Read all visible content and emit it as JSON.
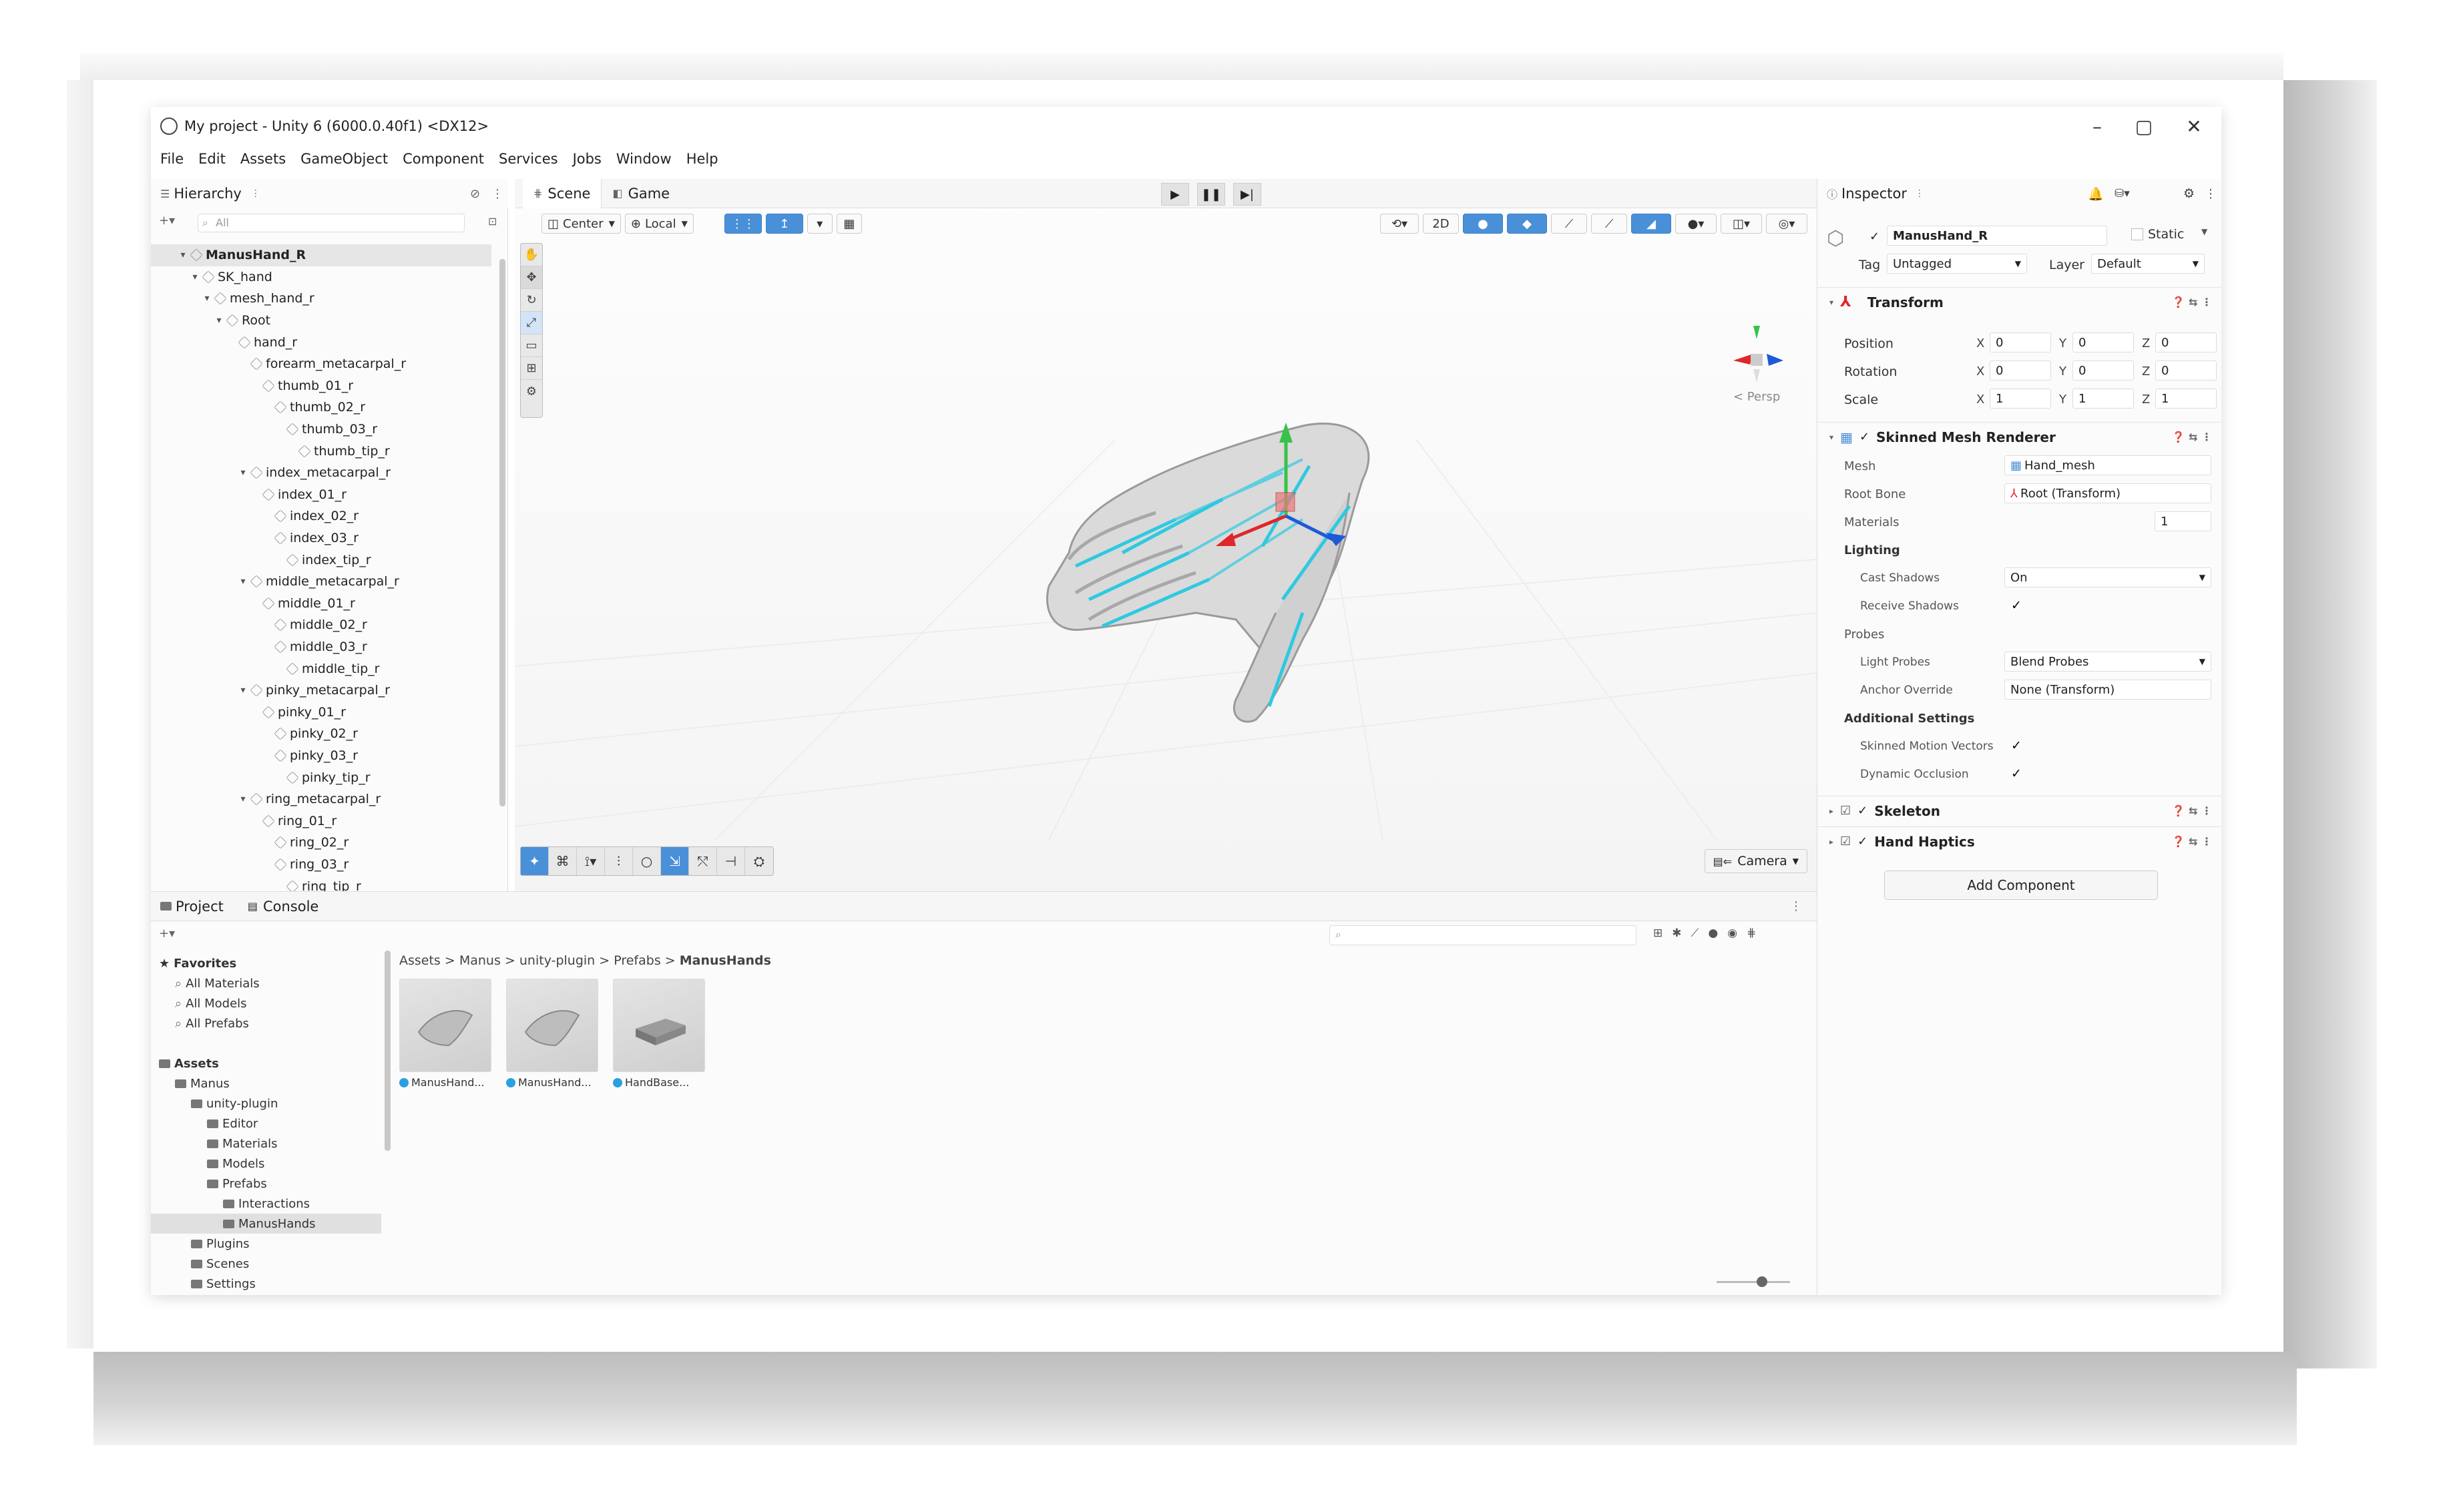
{
  "window": {
    "title": "My project - Unity 6 (6000.0.40f1) <DX12>",
    "minimize": "–",
    "maximize": "▢",
    "close": "✕"
  },
  "menu": [
    "File",
    "Edit",
    "Assets",
    "GameObject",
    "Component",
    "Services",
    "Jobs",
    "Window",
    "Help"
  ],
  "hierarchy": {
    "tab_label": "Hierarchy",
    "search_placeholder": "All",
    "items": [
      {
        "label": "ManusHand_R",
        "depth": 0,
        "caret": "▾",
        "selected": true
      },
      {
        "label": "SK_hand",
        "depth": 1,
        "caret": "▾"
      },
      {
        "label": "mesh_hand_r",
        "depth": 2,
        "caret": "▾"
      },
      {
        "label": "Root",
        "depth": 3,
        "caret": "▾"
      },
      {
        "label": "hand_r",
        "depth": 4,
        "caret": ""
      },
      {
        "label": "forearm_metacarpal_r",
        "depth": 5,
        "caret": ""
      },
      {
        "label": "thumb_01_r",
        "depth": 6,
        "caret": ""
      },
      {
        "label": "thumb_02_r",
        "depth": 7,
        "caret": ""
      },
      {
        "label": "thumb_03_r",
        "depth": 8,
        "caret": ""
      },
      {
        "label": "thumb_tip_r",
        "depth": 9,
        "caret": ""
      },
      {
        "label": "index_metacarpal_r",
        "depth": 5,
        "caret": "▾"
      },
      {
        "label": "index_01_r",
        "depth": 6,
        "caret": ""
      },
      {
        "label": "index_02_r",
        "depth": 7,
        "caret": ""
      },
      {
        "label": "index_03_r",
        "depth": 7,
        "caret": ""
      },
      {
        "label": "index_tip_r",
        "depth": 8,
        "caret": ""
      },
      {
        "label": "middle_metacarpal_r",
        "depth": 5,
        "caret": "▾"
      },
      {
        "label": "middle_01_r",
        "depth": 6,
        "caret": ""
      },
      {
        "label": "middle_02_r",
        "depth": 7,
        "caret": ""
      },
      {
        "label": "middle_03_r",
        "depth": 7,
        "caret": ""
      },
      {
        "label": "middle_tip_r",
        "depth": 8,
        "caret": ""
      },
      {
        "label": "pinky_metacarpal_r",
        "depth": 5,
        "caret": "▾"
      },
      {
        "label": "pinky_01_r",
        "depth": 6,
        "caret": ""
      },
      {
        "label": "pinky_02_r",
        "depth": 7,
        "caret": ""
      },
      {
        "label": "pinky_03_r",
        "depth": 7,
        "caret": ""
      },
      {
        "label": "pinky_tip_r",
        "depth": 8,
        "caret": ""
      },
      {
        "label": "ring_metacarpal_r",
        "depth": 5,
        "caret": "▾"
      },
      {
        "label": "ring_01_r",
        "depth": 6,
        "caret": ""
      },
      {
        "label": "ring_02_r",
        "depth": 7,
        "caret": ""
      },
      {
        "label": "ring_03_r",
        "depth": 7,
        "caret": ""
      },
      {
        "label": "ring_tip_r",
        "depth": 8,
        "caret": ""
      }
    ]
  },
  "scene": {
    "tab_scene": "Scene",
    "tab_game": "Game",
    "pivot_label": "Center",
    "space_label": "Local",
    "mode_2d": "2D",
    "persp_label": "< Persp",
    "camera_label": "Camera"
  },
  "project": {
    "tab_project": "Project",
    "tab_console": "Console",
    "tree": [
      {
        "label": "Favorites",
        "depth": 0,
        "kind": "star",
        "bold": true
      },
      {
        "label": "All Materials",
        "depth": 1,
        "kind": "search"
      },
      {
        "label": "All Models",
        "depth": 1,
        "kind": "search"
      },
      {
        "label": "All Prefabs",
        "depth": 1,
        "kind": "search"
      },
      {
        "label": "",
        "depth": 0,
        "kind": "blank"
      },
      {
        "label": "Assets",
        "depth": 0,
        "kind": "folder",
        "bold": true
      },
      {
        "label": "Manus",
        "depth": 1,
        "kind": "folder"
      },
      {
        "label": "unity-plugin",
        "depth": 2,
        "kind": "folder"
      },
      {
        "label": "Editor",
        "depth": 3,
        "kind": "folder"
      },
      {
        "label": "Materials",
        "depth": 3,
        "kind": "folder"
      },
      {
        "label": "Models",
        "depth": 3,
        "kind": "folder"
      },
      {
        "label": "Prefabs",
        "depth": 3,
        "kind": "folder"
      },
      {
        "label": "Interactions",
        "depth": 4,
        "kind": "folder"
      },
      {
        "label": "ManusHands",
        "depth": 4,
        "kind": "folder",
        "selected": true
      },
      {
        "label": "Plugins",
        "depth": 2,
        "kind": "folder"
      },
      {
        "label": "Scenes",
        "depth": 2,
        "kind": "folder"
      },
      {
        "label": "Settings",
        "depth": 2,
        "kind": "folder"
      }
    ],
    "breadcrumb": [
      "Assets",
      "Manus",
      "unity-plugin",
      "Prefabs",
      "ManusHands"
    ],
    "assets": [
      "ManusHand...",
      "ManusHand...",
      "HandBase..."
    ]
  },
  "inspector": {
    "tab_label": "Inspector",
    "object_name": "ManusHand_R",
    "static_label": "Static",
    "tag_label": "Tag",
    "tag_value": "Untagged",
    "layer_label": "Layer",
    "layer_value": "Default",
    "transform": {
      "title": "Transform",
      "position_label": "Position",
      "rotation_label": "Rotation",
      "scale_label": "Scale",
      "position": {
        "x": "0",
        "y": "0",
        "z": "0"
      },
      "rotation": {
        "x": "0",
        "y": "0",
        "z": "0"
      },
      "scale": {
        "x": "1",
        "y": "1",
        "z": "1"
      }
    },
    "smr": {
      "title": "Skinned Mesh Renderer",
      "mesh_label": "Mesh",
      "mesh_value": "Hand_mesh",
      "rootbone_label": "Root Bone",
      "rootbone_value": "Root (Transform)",
      "materials_label": "Materials",
      "materials_value": "1",
      "lighting_label": "Lighting",
      "cast_label": "Cast Shadows",
      "cast_value": "On",
      "receive_label": "Receive Shadows",
      "probes_label": "Probes",
      "lightprobes_label": "Light Probes",
      "lightprobes_value": "Blend Probes",
      "anchor_label": "Anchor Override",
      "anchor_value": "None (Transform)",
      "additional_label": "Additional Settings",
      "motion_label": "Skinned Motion Vectors",
      "occlusion_label": "Dynamic Occlusion"
    },
    "skeleton_title": "Skeleton",
    "haptics_title": "Hand Haptics",
    "add_component": "Add Component",
    "check": "✓"
  },
  "colors": {
    "accent": "#4a90d9",
    "bone": "#2ec9e0",
    "axis_x": "#e0262b",
    "axis_y": "#37c24a",
    "axis_z": "#1d5ad6"
  }
}
